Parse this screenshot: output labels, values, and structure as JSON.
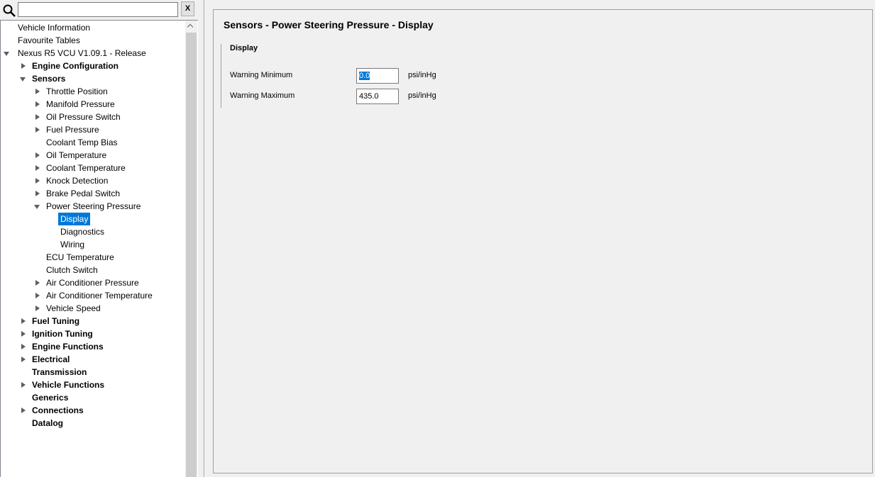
{
  "search": {
    "value": "",
    "clear_label": "X"
  },
  "tree": {
    "items": [
      {
        "label": "Vehicle Information",
        "level": 0,
        "expander": "none",
        "bold": false,
        "selected": false
      },
      {
        "label": "Favourite Tables",
        "level": 0,
        "expander": "none",
        "bold": false,
        "selected": false
      },
      {
        "label": "Nexus R5 VCU V1.09.1 - Release",
        "level": 0,
        "expander": "expanded",
        "bold": false,
        "selected": false
      },
      {
        "label": "Engine Configuration",
        "level": 1,
        "expander": "collapsed",
        "bold": true,
        "selected": false
      },
      {
        "label": "Sensors",
        "level": 1,
        "expander": "expanded",
        "bold": true,
        "selected": false
      },
      {
        "label": "Throttle Position",
        "level": 2,
        "expander": "collapsed",
        "bold": false,
        "selected": false
      },
      {
        "label": "Manifold Pressure",
        "level": 2,
        "expander": "collapsed",
        "bold": false,
        "selected": false
      },
      {
        "label": "Oil Pressure Switch",
        "level": 2,
        "expander": "collapsed",
        "bold": false,
        "selected": false
      },
      {
        "label": "Fuel Pressure",
        "level": 2,
        "expander": "collapsed",
        "bold": false,
        "selected": false
      },
      {
        "label": "Coolant Temp Bias",
        "level": 2,
        "expander": "none",
        "bold": false,
        "selected": false
      },
      {
        "label": "Oil Temperature",
        "level": 2,
        "expander": "collapsed",
        "bold": false,
        "selected": false
      },
      {
        "label": "Coolant Temperature",
        "level": 2,
        "expander": "collapsed",
        "bold": false,
        "selected": false
      },
      {
        "label": "Knock Detection",
        "level": 2,
        "expander": "collapsed",
        "bold": false,
        "selected": false
      },
      {
        "label": "Brake Pedal Switch",
        "level": 2,
        "expander": "collapsed",
        "bold": false,
        "selected": false
      },
      {
        "label": "Power Steering Pressure",
        "level": 2,
        "expander": "expanded",
        "bold": false,
        "selected": false
      },
      {
        "label": "Display",
        "level": 3,
        "expander": "none",
        "bold": false,
        "selected": true
      },
      {
        "label": "Diagnostics",
        "level": 3,
        "expander": "none",
        "bold": false,
        "selected": false
      },
      {
        "label": "Wiring",
        "level": 3,
        "expander": "none",
        "bold": false,
        "selected": false
      },
      {
        "label": "ECU Temperature",
        "level": 2,
        "expander": "none",
        "bold": false,
        "selected": false
      },
      {
        "label": "Clutch Switch",
        "level": 2,
        "expander": "none",
        "bold": false,
        "selected": false
      },
      {
        "label": "Air Conditioner Pressure",
        "level": 2,
        "expander": "collapsed",
        "bold": false,
        "selected": false
      },
      {
        "label": "Air Conditioner Temperature",
        "level": 2,
        "expander": "collapsed",
        "bold": false,
        "selected": false
      },
      {
        "label": "Vehicle Speed",
        "level": 2,
        "expander": "collapsed",
        "bold": false,
        "selected": false
      },
      {
        "label": "Fuel Tuning",
        "level": 1,
        "expander": "collapsed",
        "bold": true,
        "selected": false
      },
      {
        "label": "Ignition Tuning",
        "level": 1,
        "expander": "collapsed",
        "bold": true,
        "selected": false
      },
      {
        "label": "Engine Functions",
        "level": 1,
        "expander": "collapsed",
        "bold": true,
        "selected": false
      },
      {
        "label": "Electrical",
        "level": 1,
        "expander": "collapsed",
        "bold": true,
        "selected": false
      },
      {
        "label": "Transmission",
        "level": 1,
        "expander": "none",
        "bold": true,
        "selected": false
      },
      {
        "label": "Vehicle Functions",
        "level": 1,
        "expander": "collapsed",
        "bold": true,
        "selected": false
      },
      {
        "label": "Generics",
        "level": 1,
        "expander": "none",
        "bold": true,
        "selected": false
      },
      {
        "label": "Connections",
        "level": 1,
        "expander": "collapsed",
        "bold": true,
        "selected": false
      },
      {
        "label": "Datalog",
        "level": 1,
        "expander": "none",
        "bold": true,
        "selected": false
      }
    ]
  },
  "main": {
    "title": "Sensors - Power Steering Pressure - Display",
    "group_title": "Display",
    "fields": [
      {
        "label": "Warning Minimum",
        "value": "0.0",
        "unit": "psi/inHg",
        "selected": true
      },
      {
        "label": "Warning Maximum",
        "value": "435.0",
        "unit": "psi/inHg",
        "selected": false
      }
    ]
  },
  "colors": {
    "selection": "#0078d7",
    "panel_bg": "#f0f0f0"
  }
}
